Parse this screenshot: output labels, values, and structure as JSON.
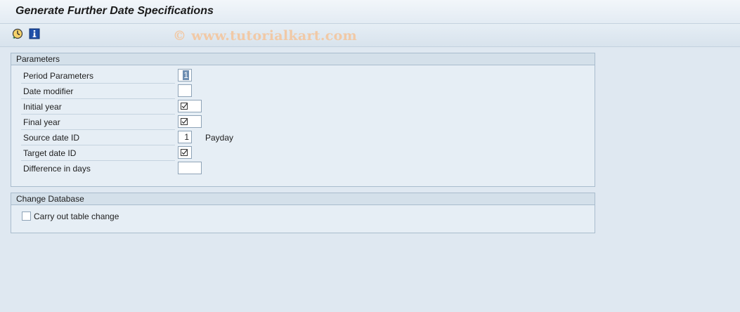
{
  "window": {
    "title": "Generate Further Date Specifications"
  },
  "toolbar": {
    "items": [
      {
        "icon": "execute-clock-icon"
      },
      {
        "icon": "info-icon"
      }
    ],
    "watermark": "© www.tutorialkart.com"
  },
  "parameters": {
    "title": "Parameters",
    "fields": [
      {
        "label": "Period Parameters",
        "value": "1",
        "type": "small-selected"
      },
      {
        "label": "Date modifier",
        "value": "",
        "type": "small"
      },
      {
        "label": "Initial year",
        "value": "",
        "type": "wide-required"
      },
      {
        "label": "Final year",
        "value": "",
        "type": "wide-required"
      },
      {
        "label": "Source date ID",
        "value": "1",
        "type": "small",
        "suffix": "Payday"
      },
      {
        "label": "Target date ID",
        "value": "",
        "type": "small-required"
      },
      {
        "label": "Difference in days",
        "value": "",
        "type": "wide"
      }
    ]
  },
  "change_database": {
    "title": "Change Database",
    "checkbox_label": "Carry out table change",
    "checked": false
  }
}
